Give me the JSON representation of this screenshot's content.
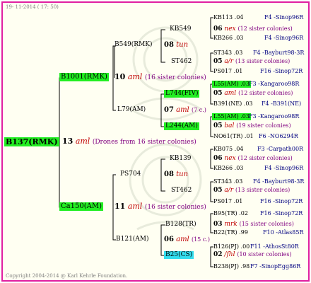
{
  "header": {
    "date": "19- 11-2014 ( 17: 50)"
  },
  "footer": {
    "copyright": "Copyright 2004-2014 @ Karl Kehrle Foundation."
  },
  "root": {
    "name": "B137(RMK)",
    "gen": "13",
    "mark": "aml",
    "note": "(Drones from 16 sister colonies)"
  },
  "fathers": [
    {
      "name": "B1001(RMK)",
      "gen": "10",
      "mark": "aml",
      "note": "(16 sister colonies)"
    },
    {
      "name": "Ca150(AM)",
      "gen": "11",
      "mark": "aml",
      "note": "(16 sister colonies)"
    }
  ],
  "gen3": [
    {
      "name": "B549(RMK)",
      "gen": "08",
      "mark": "tun"
    },
    {
      "name": "L79(AM)",
      "gen": "07",
      "mark": "aml",
      "note": "(7 c.)"
    },
    {
      "name": "PS704",
      "gen": "08",
      "mark": "tun"
    },
    {
      "name": "B121(AM)",
      "gen": "06",
      "mark": "aml",
      "note": "(15 c.)"
    }
  ],
  "gen4": [
    {
      "name": "KB549",
      "gen": "06",
      "mark": "nex",
      "note": "(12 sister colonies)"
    },
    {
      "name": "ST462",
      "gen": "05",
      "mark": "a/r",
      "note": "(13 sister colonies)"
    },
    {
      "name": "L744(FIV)",
      "gen": "05",
      "mark": "aml",
      "note": "(12 sister colonies)"
    },
    {
      "name": "L244(AM)",
      "gen": "05",
      "mark": "bal",
      "note": "(19 sister colonies)"
    },
    {
      "name": "KB139",
      "gen": "06",
      "mark": "nex",
      "note": "(12 sister colonies)"
    },
    {
      "name": "ST462",
      "gen": "05",
      "mark": "a/r",
      "note": "(13 sister colonies)"
    },
    {
      "name": "B128(TR)",
      "gen": "03",
      "mark": "mrk",
      "note": "(15 sister colonies)"
    },
    {
      "name": "B25(CS)",
      "gen": "02",
      "mark": "/fhl",
      "note": "(10 sister colonies)"
    }
  ],
  "gen5": [
    {
      "name": "KB113 .04",
      "code": "F4 -Sinop96R"
    },
    {
      "name": "KB266 .03",
      "code": "F4 -Sinop96R"
    },
    {
      "name": "ST343 .03",
      "code": "F4 -Bayburt98-3R"
    },
    {
      "name": "PS017 .01",
      "code": "F16 -Sinop72R"
    },
    {
      "name": "L55(AM) .03",
      "code": "F3 -Kangaroo98R"
    },
    {
      "name": "B391(NE) .03",
      "code": "F4 -B391(NE)"
    },
    {
      "name": "L55(AM) .03",
      "code": "F3 -Kangaroo98R"
    },
    {
      "name": "NO61(TR) .01",
      "code": "F6 -NO6294R"
    },
    {
      "name": "KB075 .04",
      "code": "F3 -Carpath00R"
    },
    {
      "name": "KB266 .03",
      "code": "F4 -Sinop96R"
    },
    {
      "name": "ST343 .03",
      "code": "F4 -Bayburt98-3R"
    },
    {
      "name": "PS017 .01",
      "code": "F16 -Sinop72R"
    },
    {
      "name": "B95(TR) .02",
      "code": "F16 -Sinop72R"
    },
    {
      "name": "B22(TR) .99",
      "code": "F10 -Atlas85R"
    },
    {
      "name": "B126(PJ) .00",
      "code": "F11 -AthosSt80R"
    },
    {
      "name": "B238(PJ) .98",
      "code": "F7 -SinopEgg86R"
    }
  ],
  "colors": {
    "border": "#e020a0",
    "highlight_green": "#22ee22",
    "highlight_cyan": "#33ddee",
    "mark": "#c00000",
    "note": "#800080",
    "code": "#000080"
  }
}
